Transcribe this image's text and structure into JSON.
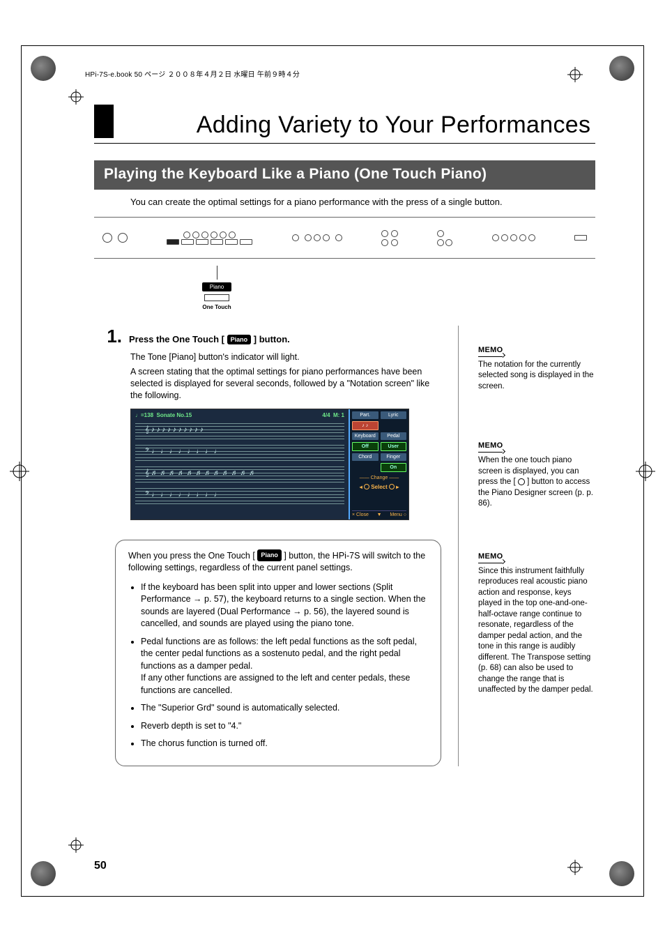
{
  "header_line": "HPi-7S-e.book  50 ページ  ２００８年４月２日  水曜日  午前９時４分",
  "main_title": "Adding Variety to Your Performances",
  "section_title": "Playing the Keyboard Like a Piano (One Touch Piano)",
  "intro": "You can create the optimal settings for a piano performance with the press of a single button.",
  "callout": {
    "badge": "Piano",
    "label": "One Touch"
  },
  "step1": {
    "num": "1.",
    "title_before": "Press the One Touch [",
    "title_badge": "Piano",
    "title_after": "] button.",
    "p1": "The Tone [Piano] button's indicator will light.",
    "p2": "A screen stating that the optimal settings for piano performances have been selected is displayed for several seconds, followed by a \"Notation screen\" like the following."
  },
  "screen": {
    "tempo": "♩=138",
    "title": "Sonate No.15",
    "timesig": "4/4",
    "measure": "M:   1",
    "side": {
      "part_l": "Part.",
      "part_r": "Lyric",
      "part_rv": "♪ ♪",
      "kb_l": "Keyboard",
      "kb_r": "Pedal",
      "kb_lv": "Off",
      "kb_rv": "User",
      "ch_l": "Chord",
      "ch_r": "Finger",
      "ch_rv": "On",
      "change": "Change",
      "select": "Select",
      "close": "× Close",
      "menu": "Menu ○"
    }
  },
  "tip": {
    "lead_before": "When you press the One Touch [",
    "lead_badge": "Piano",
    "lead_after": "] button, the HPi-7S will switch to the following settings, regardless of the current panel settings.",
    "items": [
      "If the keyboard has been split into upper and lower sections (Split Performance → p. 57), the keyboard returns to a single section. When the sounds are layered (Dual Performance → p. 56), the layered sound is cancelled, and sounds are played using the piano tone.",
      "Pedal functions are as follows: the left pedal functions as the soft pedal, the center pedal functions as a sostenuto pedal, and the right pedal functions as a damper pedal.\nIf any other functions are assigned to the left and center pedals, these functions are cancelled.",
      "The \"Superior Grd\" sound is automatically selected.",
      "Reverb depth is set to \"4.\"",
      "The chorus function is turned off."
    ]
  },
  "memos": [
    {
      "hdr": "MEMO",
      "body": "The notation for the currently selected song is displayed in the screen."
    },
    {
      "hdr": "MEMO",
      "body_before": "When the one touch piano screen is displayed, you can press the [ ",
      "body_after": " ] button to access the Piano Designer screen (p. p. 86)."
    },
    {
      "hdr": "MEMO",
      "body": "Since this instrument faithfully reproduces real acoustic piano action and response, keys played in the top one-and-one-half-octave range continue to resonate, regardless of the damper pedal action, and the tone in this range is audibly different. The Transpose setting (p. 68) can also be used to change the range that is unaffected by the damper pedal."
    }
  ],
  "page_num": "50"
}
